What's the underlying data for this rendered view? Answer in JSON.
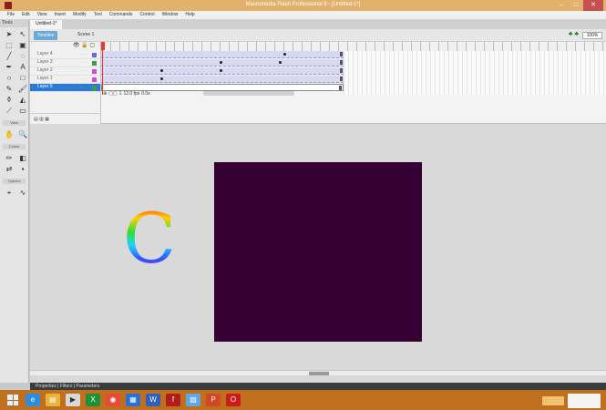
{
  "window": {
    "title": "Macromedia Flash Professional 8 - [Untitled-1*]",
    "controls": [
      "–",
      "□",
      "✕"
    ]
  },
  "menu": {
    "items": [
      "File",
      "Edit",
      "View",
      "Insert",
      "Modify",
      "Text",
      "Commands",
      "Control",
      "Window",
      "Help"
    ]
  },
  "tools": {
    "header": "Tools",
    "sections": [
      "View",
      "Colors",
      "Options"
    ]
  },
  "document": {
    "tabs": [
      "Untitled-1*"
    ],
    "timeline_tab": "Timeline",
    "scene": "Scene 1",
    "zoom": "100%"
  },
  "layers": [
    {
      "name": "Layer 4",
      "color": "#6b6bd8"
    },
    {
      "name": "Layer 3",
      "color": "#3ca03c"
    },
    {
      "name": "Layer 2",
      "color": "#d04ad0"
    },
    {
      "name": "Layer 1",
      "color": "#d04ad0"
    },
    {
      "name": "Layer 5",
      "color": "#3ca03c",
      "selected": true
    }
  ],
  "layer_footer": "",
  "timeline_controls": {
    "frame": "1",
    "fps": "12.0 fps",
    "time": "0.0s"
  },
  "stage": {
    "background": "#350033",
    "letter": "C"
  },
  "status": {
    "text": "Properties | Filters | Parameters"
  },
  "taskbar": {
    "icons": [
      "ie-icon",
      "explorer-icon",
      "media-icon",
      "excel-icon",
      "chrome-icon",
      "store-icon",
      "word-icon",
      "flash-icon",
      "paint-icon",
      "powerpoint-icon",
      "opera-icon"
    ],
    "clock_time": "",
    "clock_date": ""
  }
}
